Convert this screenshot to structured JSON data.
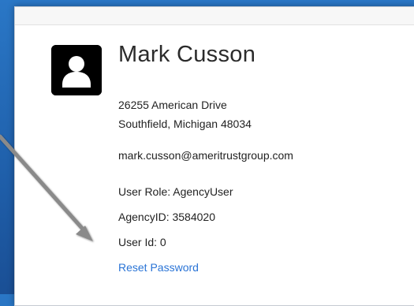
{
  "profile": {
    "name": "Mark Cusson",
    "address_line1": "26255 American Drive",
    "address_line2": "Southfield, Michigan 48034",
    "email": "mark.cusson@ameritrustgroup.com",
    "user_role": "User Role: AgencyUser",
    "agency_id": "AgencyID: 3584020",
    "user_id": "User Id: 0",
    "reset_password_label": "Reset Password"
  },
  "icons": {
    "avatar": "user-avatar-icon",
    "annotation": "annotation-arrow-icon"
  },
  "colors": {
    "link": "#2a74d6",
    "avatar_bg": "#000000",
    "arrow": "#8a8a8a"
  }
}
